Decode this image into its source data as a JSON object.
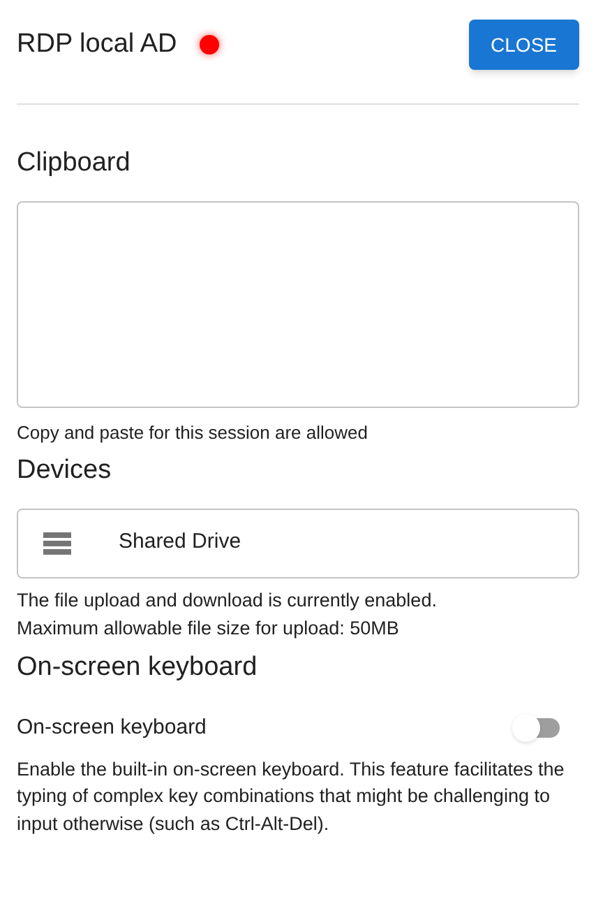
{
  "header": {
    "title": "RDP local AD",
    "status": {
      "color": "#ff0000"
    },
    "close_button": "CLOSE"
  },
  "clipboard": {
    "heading": "Clipboard",
    "caption": "Copy and paste for this session are allowed"
  },
  "devices": {
    "heading": "Devices",
    "items": [
      {
        "label": "Shared Drive"
      }
    ],
    "notes": [
      "The file upload and download is currently enabled.",
      "Maximum allowable file size for upload: 50MB"
    ]
  },
  "keyboard": {
    "heading": "On-screen keyboard",
    "setting": {
      "label": "On-screen keyboard",
      "on": false
    },
    "description": "Enable the built-in on-screen keyboard. This feature facilitates the typing of complex key combinations that might be challenging to input otherwise (such as Ctrl-Alt-Del)."
  }
}
